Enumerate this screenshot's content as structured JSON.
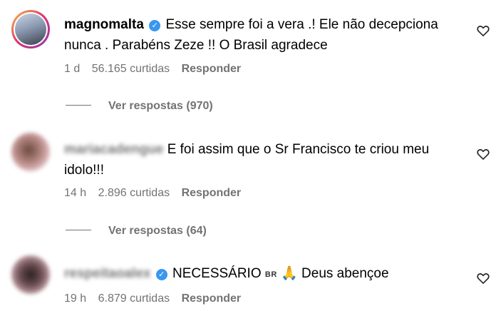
{
  "comments": [
    {
      "username": "magnomalta",
      "verified": true,
      "text": "Esse sempre foi a vera .! Ele não decepciona nunca . Parabéns Zeze !! O Brasil agradece",
      "time": "1 d",
      "likes": "56.165 curtidas",
      "reply": "Responder",
      "view_replies": "Ver respostas (970)"
    },
    {
      "username": "mariacadengue",
      "verified": false,
      "text": "E foi assim que o Sr Francisco te criou meu idolo!!!",
      "time": "14 h",
      "likes": "2.896 curtidas",
      "reply": "Responder",
      "view_replies": "Ver respostas (64)"
    },
    {
      "username": "respeitaoalex",
      "verified": true,
      "text_before": "NECESSÁRIO",
      "flag": "BR",
      "emoji": "🙏",
      "text_after": "Deus abençoe",
      "time": "19 h",
      "likes": "6.879 curtidas",
      "reply": "Responder"
    }
  ],
  "icons": {
    "heart": "heart-outline-icon",
    "verified": "verified-badge-icon"
  },
  "colors": {
    "meta": "#737373",
    "verified": "#3897f0"
  }
}
